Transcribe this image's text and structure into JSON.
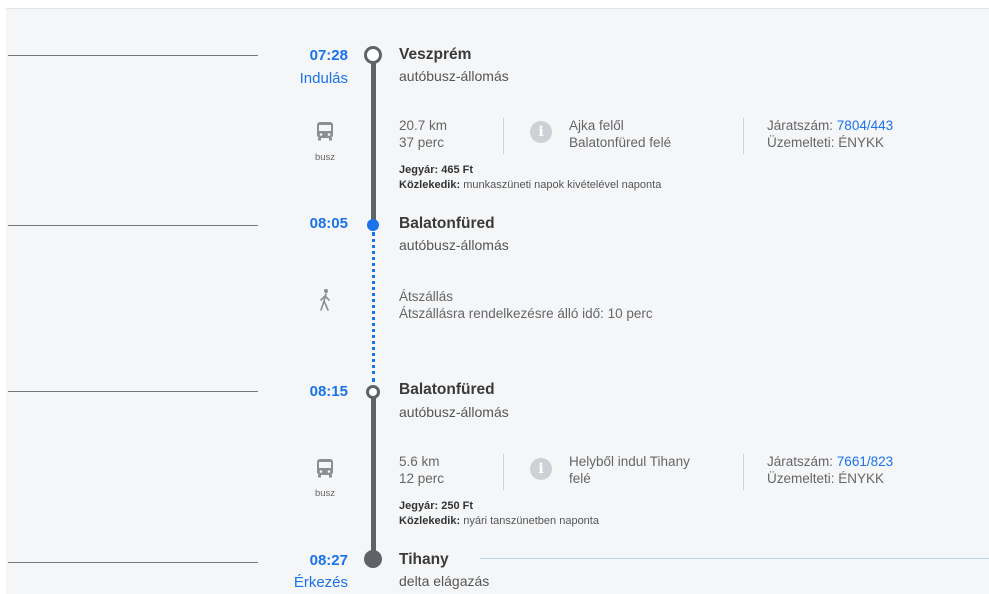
{
  "stops": [
    {
      "time": "07:28",
      "time_label": "Indulás",
      "name": "Veszprém",
      "sub": "autóbusz-állomás"
    },
    {
      "time": "08:05",
      "name": "Balatonfüred",
      "sub": "autóbusz-állomás"
    },
    {
      "time": "08:15",
      "name": "Balatonfüred",
      "sub": "autóbusz-állomás"
    },
    {
      "time": "08:27",
      "time_label": "Érkezés",
      "name": "Tihany",
      "sub": "delta elágazás"
    }
  ],
  "legs": [
    {
      "mode": "busz",
      "distance": "20.7 km",
      "duration": "37 perc",
      "direction_from": "Ajka felől",
      "direction_to": "Balatonfüred felé",
      "route_label": "Járatszám:",
      "route_number": "7804/443",
      "operator": "Üzemelteti: ÉNYKK",
      "fare_label": "Jegyár:",
      "fare": "465 Ft",
      "service_label": "Közlekedik:",
      "service": "munkaszüneti napok kivételével naponta"
    },
    {
      "mode": "busz",
      "distance": "5.6 km",
      "duration": "12 perc",
      "direction_from": "Helyből indul Tihany",
      "direction_to": "felé",
      "route_label": "Járatszám:",
      "route_number": "7661/823",
      "operator": "Üzemelteti: ÉNYKK",
      "fare_label": "Jegyár:",
      "fare": "250 Ft",
      "service_label": "Közlekedik:",
      "service": "nyári tanszünetben naponta"
    }
  ],
  "transfer": {
    "title": "Átszállás",
    "detail": "Átszállásra rendelkezésre álló idő: 10 perc"
  },
  "colors": {
    "accent": "#1a73e8",
    "line": "#5f6368",
    "background": "#f5f6f8"
  }
}
